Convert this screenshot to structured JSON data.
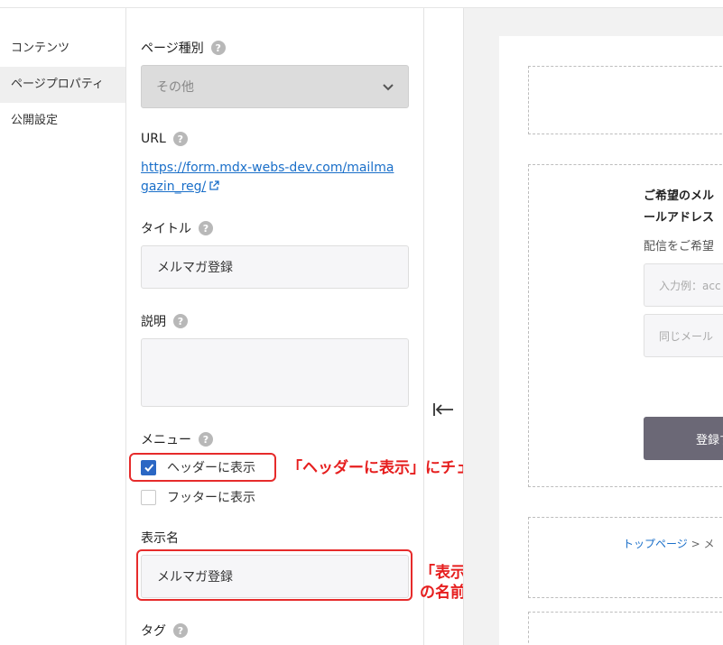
{
  "nav": {
    "items": [
      {
        "label": "コンテンツ",
        "active": false
      },
      {
        "label": "ページプロパティ",
        "active": true
      },
      {
        "label": "公開設定",
        "active": false
      }
    ]
  },
  "panel": {
    "page_type": {
      "label": "ページ種別",
      "value": "その他"
    },
    "url": {
      "label": "URL",
      "link_line1": "https://form.mdx-webs-dev.com/mailma",
      "link_line2": "gazin_reg/"
    },
    "title": {
      "label": "タイトル",
      "value": "メルマガ登録"
    },
    "description": {
      "label": "説明",
      "value": ""
    },
    "menu": {
      "label": "メニュー",
      "header_label": "ヘッダーに表示",
      "header_checked": true,
      "footer_label": "フッターに表示",
      "footer_checked": false
    },
    "display_name": {
      "label": "表示名",
      "value": "メルマガ登録"
    },
    "tag": {
      "label": "タグ"
    },
    "help_glyph": "?"
  },
  "annotations": {
    "note1": "「ヘッダーに表示」にチェックを入れます",
    "note2_line1": "「表示名」にメニューに表示するページ",
    "note2_line2": "の名前を入力します。",
    "color": "#e62b2b"
  },
  "preview": {
    "heading_line1": "ご希望のメル",
    "heading_line2": "ールアドレス",
    "sub": "配信をご希望",
    "input1_placeholder": "入力例：acc",
    "input2_placeholder": "同じメール",
    "button": "登録す",
    "breadcrumb_link": "トップページ",
    "breadcrumb_sep": ">",
    "breadcrumb_current": "メ"
  },
  "colors": {
    "accent": "#2b67c4",
    "link": "#1a6fc9",
    "button": "#6b6876"
  }
}
